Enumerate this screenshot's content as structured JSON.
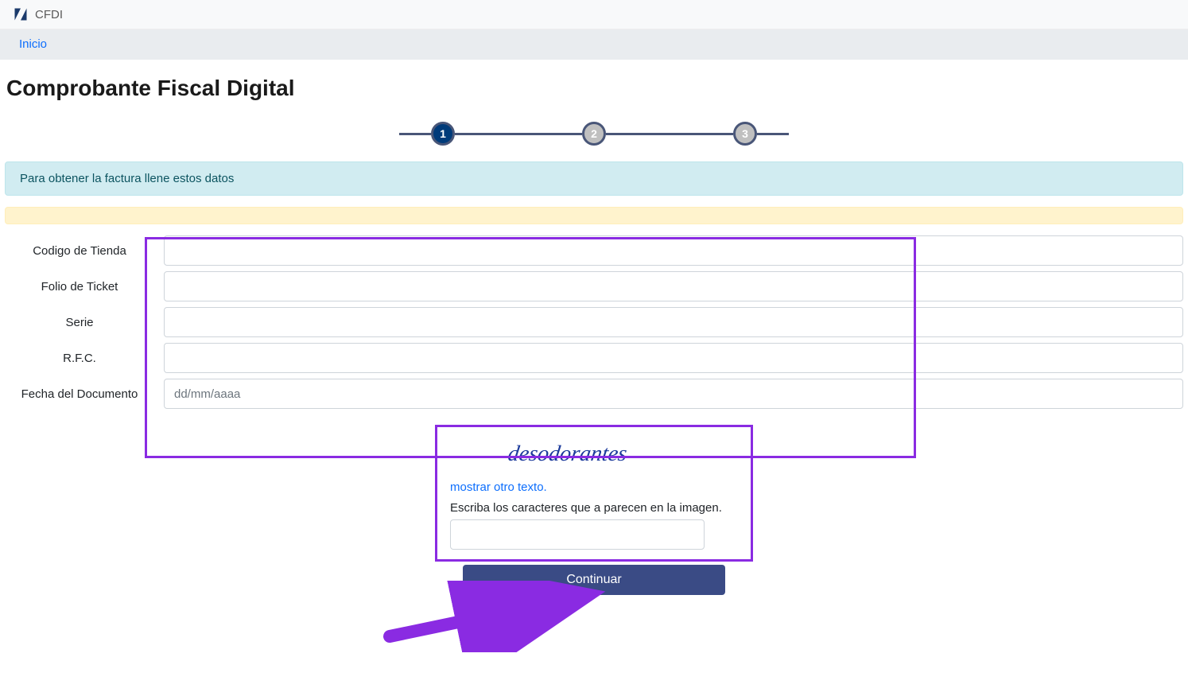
{
  "topbar": {
    "brand": "CFDI"
  },
  "nav": {
    "home": "Inicio"
  },
  "page": {
    "title": "Comprobante Fiscal Digital"
  },
  "stepper": {
    "step1": "1",
    "step2": "2",
    "step3": "3",
    "active": 1
  },
  "alerts": {
    "info": "Para obtener la factura llene estos datos",
    "warning": ""
  },
  "form": {
    "fields": {
      "codigo_tienda": {
        "label": "Codigo de Tienda",
        "value": ""
      },
      "folio_ticket": {
        "label": "Folio de Ticket",
        "value": ""
      },
      "serie": {
        "label": "Serie",
        "value": ""
      },
      "rfc": {
        "label": "R.F.C.",
        "value": ""
      },
      "fecha_documento": {
        "label": "Fecha del Documento",
        "value": "",
        "placeholder": "dd/mm/aaaa"
      }
    }
  },
  "captcha": {
    "image_text": "desodorantes",
    "refresh_link": "mostrar otro texto.",
    "label": "Escriba los caracteres que a parecen en la imagen.",
    "value": ""
  },
  "buttons": {
    "continue": "Continuar"
  }
}
